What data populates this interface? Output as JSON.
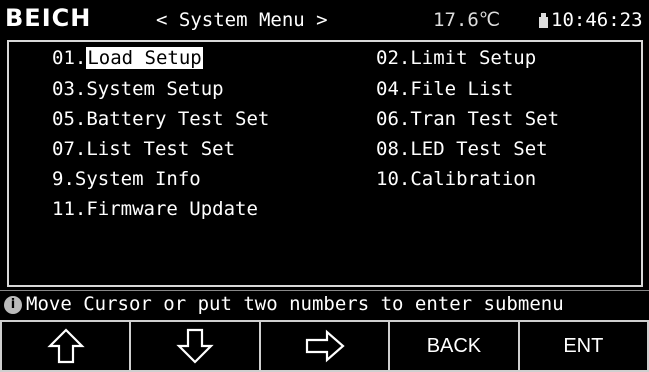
{
  "header": {
    "brand": "BEICH",
    "title": "< System Menu >",
    "temperature": "17.6℃",
    "clock": "10:46:23",
    "usb_icon": "usb-drive-icon"
  },
  "menu": {
    "items": [
      {
        "num": "01.",
        "label": "Load Setup",
        "selected": true
      },
      {
        "num": "02.",
        "label": "Limit Setup"
      },
      {
        "num": "03.",
        "label": "System Setup"
      },
      {
        "num": "04.",
        "label": "File List"
      },
      {
        "num": "05.",
        "label": "Battery Test Set"
      },
      {
        "num": "06.",
        "label": "Tran Test Set"
      },
      {
        "num": "07.",
        "label": "List Test Set"
      },
      {
        "num": "08.",
        "label": "LED Test Set"
      },
      {
        "num": "9.",
        "label": "System Info"
      },
      {
        "num": "10.",
        "label": "Calibration"
      },
      {
        "num": "11.",
        "label": "Firmware Update"
      }
    ]
  },
  "status": {
    "icon": "info-icon",
    "icon_glyph": "i",
    "message": "Move Cursor or put two numbers to enter submenu"
  },
  "softkeys": [
    {
      "icon": "arrow-up-icon"
    },
    {
      "icon": "arrow-down-icon"
    },
    {
      "icon": "arrow-right-icon"
    },
    {
      "label": "BACK"
    },
    {
      "label": "ENT"
    }
  ],
  "colors": {
    "background": "#000000",
    "text": "#ffffff",
    "selection_bg": "#ffffff",
    "selection_text": "#000000",
    "border": "#d8d8d8"
  }
}
